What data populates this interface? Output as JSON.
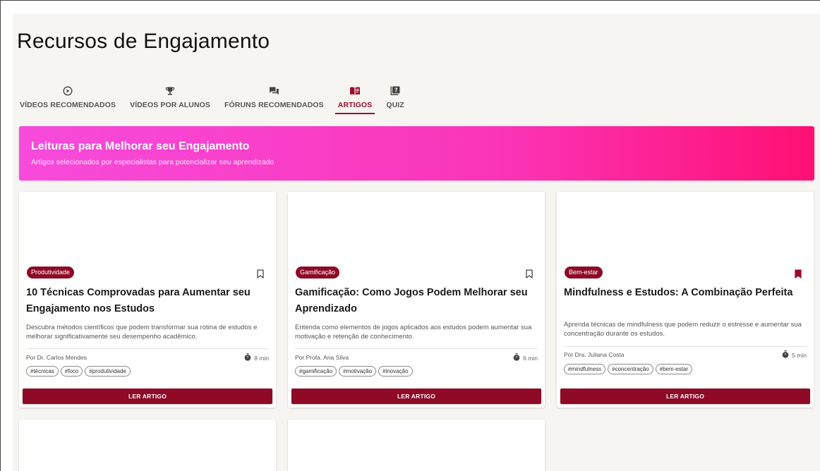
{
  "page_title": "Recursos de Engajamento",
  "tabs": [
    {
      "label": "VÍDEOS RECOMENDADOS",
      "icon": "play-circle-icon",
      "active": false
    },
    {
      "label": "VÍDEOS POR ALUNOS",
      "icon": "trophy-icon",
      "active": false
    },
    {
      "label": "FÓRUNS RECOMENDADOS",
      "icon": "forum-icon",
      "active": false
    },
    {
      "label": "ARTIGOS",
      "icon": "book-open-icon",
      "active": true
    },
    {
      "label": "QUIZ",
      "icon": "quiz-icon",
      "active": false
    }
  ],
  "banner": {
    "title": "Leituras para Melhorar seu Engajamento",
    "subtitle": "Artigos selecionados por especialistas para potencializar seu aprendizado"
  },
  "colors": {
    "accent": "#8e0a26",
    "banner_start": "#f74bdc",
    "banner_end": "#ff1073"
  },
  "articles": [
    {
      "category": "Produtividade",
      "bookmarked": false,
      "title": "10 Técnicas Comprovadas para Aumentar seu Engajamento nos Estudos",
      "description": "Descubra métodos científicos que podem transformar sua rotina de estudos e melhorar significativamente seu desempenho acadêmico.",
      "author": "Por Dr. Carlos Mendes",
      "read_time": "8 min",
      "tags": [
        "#técnicas",
        "#foco",
        "#produtividade"
      ],
      "button_label": "LER ARTIGO"
    },
    {
      "category": "Gamificação",
      "bookmarked": false,
      "title": "Gamificação: Como Jogos Podem Melhorar seu Aprendizado",
      "description": "Entenda como elementos de jogos aplicados aos estudos podem aumentar sua motivação e retenção de conhecimento.",
      "author": "Por Profa. Ana Silva",
      "read_time": "6 min",
      "tags": [
        "#gamificação",
        "#motivação",
        "#inovação"
      ],
      "button_label": "LER ARTIGO"
    },
    {
      "category": "Bem-estar",
      "bookmarked": true,
      "title": "Mindfulness e Estudos: A Combinação Perfeita",
      "description": "Aprenda técnicas de mindfulness que podem reduzir o estresse e aumentar sua concentração durante os estudos.",
      "author": "Por Dra. Juliana Costa",
      "read_time": "5 min",
      "tags": [
        "#mindfulness",
        "#concentração",
        "#bem-estar"
      ],
      "button_label": "LER ARTIGO"
    }
  ]
}
